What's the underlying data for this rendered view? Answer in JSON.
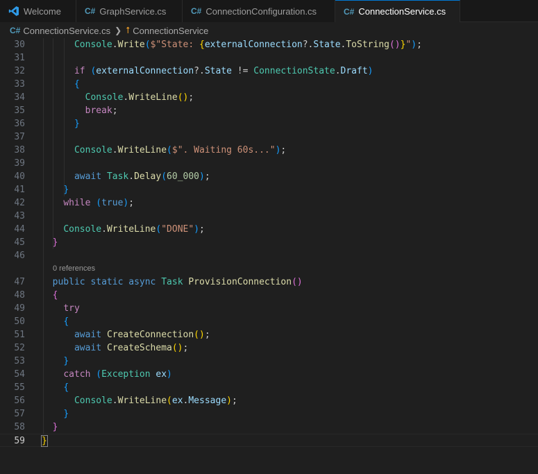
{
  "tabs": [
    {
      "label": "Welcome",
      "icon": "vscode-logo-icon",
      "active": false
    },
    {
      "label": "GraphService.cs",
      "icon": "csharp-file-icon",
      "active": false
    },
    {
      "label": "ConnectionConfiguration.cs",
      "icon": "csharp-file-icon",
      "active": false
    },
    {
      "label": "ConnectionService.cs",
      "icon": "csharp-file-icon",
      "active": true,
      "dirty": true
    }
  ],
  "breadcrumb": {
    "file": "ConnectionService.cs",
    "symbol": "ConnectionService"
  },
  "editor": {
    "current_line": 59,
    "code_lens": "0 references",
    "lines": [
      {
        "n": 30,
        "tokens": [
          [
            "      ",
            "pn"
          ],
          [
            "Console",
            "ty"
          ],
          [
            ".",
            "pn"
          ],
          [
            "Write",
            "fn"
          ],
          [
            "(",
            "b3"
          ],
          [
            "$\"State: ",
            "str"
          ],
          [
            "{",
            "b1"
          ],
          [
            "externalConnection",
            "var"
          ],
          [
            "?.",
            "pn"
          ],
          [
            "State",
            "var"
          ],
          [
            ".",
            "pn"
          ],
          [
            "ToString",
            "fn"
          ],
          [
            "()",
            "b2"
          ],
          [
            "}",
            "b1"
          ],
          [
            "\"",
            "str"
          ],
          [
            ")",
            "b3"
          ],
          [
            ";",
            "pn"
          ]
        ]
      },
      {
        "n": 31,
        "tokens": []
      },
      {
        "n": 32,
        "tokens": [
          [
            "      ",
            "pn"
          ],
          [
            "if",
            "ctl"
          ],
          [
            " ",
            "pn"
          ],
          [
            "(",
            "b3"
          ],
          [
            "externalConnection",
            "var"
          ],
          [
            "?.",
            "pn"
          ],
          [
            "State",
            "var"
          ],
          [
            " != ",
            "pn"
          ],
          [
            "ConnectionState",
            "ty"
          ],
          [
            ".",
            "pn"
          ],
          [
            "Draft",
            "var"
          ],
          [
            ")",
            "b3"
          ]
        ]
      },
      {
        "n": 33,
        "tokens": [
          [
            "      ",
            "pn"
          ],
          [
            "{",
            "b3"
          ]
        ]
      },
      {
        "n": 34,
        "tokens": [
          [
            "        ",
            "pn"
          ],
          [
            "Console",
            "ty"
          ],
          [
            ".",
            "pn"
          ],
          [
            "WriteLine",
            "fn"
          ],
          [
            "()",
            "b1"
          ],
          [
            ";",
            "pn"
          ]
        ]
      },
      {
        "n": 35,
        "tokens": [
          [
            "        ",
            "pn"
          ],
          [
            "break",
            "ctl"
          ],
          [
            ";",
            "pn"
          ]
        ]
      },
      {
        "n": 36,
        "tokens": [
          [
            "      ",
            "pn"
          ],
          [
            "}",
            "b3"
          ]
        ]
      },
      {
        "n": 37,
        "tokens": []
      },
      {
        "n": 38,
        "tokens": [
          [
            "      ",
            "pn"
          ],
          [
            "Console",
            "ty"
          ],
          [
            ".",
            "pn"
          ],
          [
            "WriteLine",
            "fn"
          ],
          [
            "(",
            "b3"
          ],
          [
            "$\". Waiting 60s...\"",
            "str"
          ],
          [
            ")",
            "b3"
          ],
          [
            ";",
            "pn"
          ]
        ]
      },
      {
        "n": 39,
        "tokens": []
      },
      {
        "n": 40,
        "tokens": [
          [
            "      ",
            "pn"
          ],
          [
            "await",
            "kw"
          ],
          [
            " ",
            "pn"
          ],
          [
            "Task",
            "ty"
          ],
          [
            ".",
            "pn"
          ],
          [
            "Delay",
            "fn"
          ],
          [
            "(",
            "b3"
          ],
          [
            "60_000",
            "num"
          ],
          [
            ")",
            "b3"
          ],
          [
            ";",
            "pn"
          ]
        ]
      },
      {
        "n": 41,
        "tokens": [
          [
            "    ",
            "pn"
          ],
          [
            "}",
            "b3"
          ]
        ]
      },
      {
        "n": 42,
        "tokens": [
          [
            "    ",
            "pn"
          ],
          [
            "while",
            "ctl"
          ],
          [
            " ",
            "pn"
          ],
          [
            "(",
            "b3"
          ],
          [
            "true",
            "kw"
          ],
          [
            ")",
            "b3"
          ],
          [
            ";",
            "pn"
          ]
        ]
      },
      {
        "n": 43,
        "tokens": []
      },
      {
        "n": 44,
        "tokens": [
          [
            "    ",
            "pn"
          ],
          [
            "Console",
            "ty"
          ],
          [
            ".",
            "pn"
          ],
          [
            "WriteLine",
            "fn"
          ],
          [
            "(",
            "b3"
          ],
          [
            "\"DONE\"",
            "str"
          ],
          [
            ")",
            "b3"
          ],
          [
            ";",
            "pn"
          ]
        ]
      },
      {
        "n": 45,
        "tokens": [
          [
            "  ",
            "pn"
          ],
          [
            "}",
            "b2"
          ]
        ]
      },
      {
        "n": 46,
        "tokens": []
      },
      {
        "n": 47,
        "tokens": [
          [
            "  ",
            "pn"
          ],
          [
            "public",
            "kw"
          ],
          [
            " ",
            "pn"
          ],
          [
            "static",
            "kw"
          ],
          [
            " ",
            "pn"
          ],
          [
            "async",
            "kw"
          ],
          [
            " ",
            "pn"
          ],
          [
            "Task",
            "ty"
          ],
          [
            " ",
            "pn"
          ],
          [
            "ProvisionConnection",
            "fn"
          ],
          [
            "()",
            "b2"
          ]
        ]
      },
      {
        "n": 48,
        "tokens": [
          [
            "  ",
            "pn"
          ],
          [
            "{",
            "b2"
          ]
        ]
      },
      {
        "n": 49,
        "tokens": [
          [
            "    ",
            "pn"
          ],
          [
            "try",
            "ctl"
          ]
        ]
      },
      {
        "n": 50,
        "tokens": [
          [
            "    ",
            "pn"
          ],
          [
            "{",
            "b3"
          ]
        ]
      },
      {
        "n": 51,
        "tokens": [
          [
            "      ",
            "pn"
          ],
          [
            "await",
            "kw"
          ],
          [
            " ",
            "pn"
          ],
          [
            "CreateConnection",
            "fn"
          ],
          [
            "()",
            "b1"
          ],
          [
            ";",
            "pn"
          ]
        ]
      },
      {
        "n": 52,
        "tokens": [
          [
            "      ",
            "pn"
          ],
          [
            "await",
            "kw"
          ],
          [
            " ",
            "pn"
          ],
          [
            "CreateSchema",
            "fn"
          ],
          [
            "()",
            "b1"
          ],
          [
            ";",
            "pn"
          ]
        ]
      },
      {
        "n": 53,
        "tokens": [
          [
            "    ",
            "pn"
          ],
          [
            "}",
            "b3"
          ]
        ]
      },
      {
        "n": 54,
        "tokens": [
          [
            "    ",
            "pn"
          ],
          [
            "catch",
            "ctl"
          ],
          [
            " ",
            "pn"
          ],
          [
            "(",
            "b3"
          ],
          [
            "Exception",
            "ty"
          ],
          [
            " ",
            "pn"
          ],
          [
            "ex",
            "var"
          ],
          [
            ")",
            "b3"
          ]
        ]
      },
      {
        "n": 55,
        "tokens": [
          [
            "    ",
            "pn"
          ],
          [
            "{",
            "b3"
          ]
        ]
      },
      {
        "n": 56,
        "tokens": [
          [
            "      ",
            "pn"
          ],
          [
            "Console",
            "ty"
          ],
          [
            ".",
            "pn"
          ],
          [
            "WriteLine",
            "fn"
          ],
          [
            "(",
            "b1"
          ],
          [
            "ex",
            "var"
          ],
          [
            ".",
            "pn"
          ],
          [
            "Message",
            "var"
          ],
          [
            ")",
            "b1"
          ],
          [
            ";",
            "pn"
          ]
        ]
      },
      {
        "n": 57,
        "tokens": [
          [
            "    ",
            "pn"
          ],
          [
            "}",
            "b3"
          ]
        ]
      },
      {
        "n": 58,
        "tokens": [
          [
            "  ",
            "pn"
          ],
          [
            "}",
            "b2"
          ]
        ]
      },
      {
        "n": 59,
        "tokens": [
          [
            "}",
            "b1"
          ]
        ]
      }
    ]
  }
}
